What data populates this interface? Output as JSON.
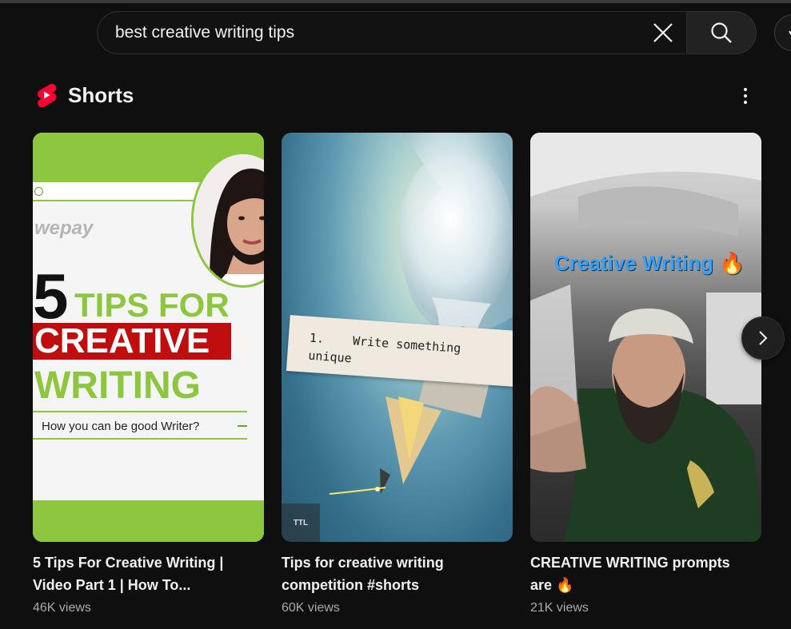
{
  "search": {
    "query": "best creative writing tips"
  },
  "section": {
    "title": "Shorts"
  },
  "icons": {
    "clear": "close-icon",
    "search": "search-icon",
    "more": "more-vert-icon",
    "next": "chevron-right-icon",
    "shorts": "shorts-logo-icon"
  },
  "colors": {
    "background": "#0f0f0f",
    "shorts_red": "#ff0033",
    "views_text": "#aaaaaa"
  },
  "cards": [
    {
      "title_line1": "5 Tips For Creative Writing |",
      "title_line2": "Video Part 1 | How To...",
      "views": "46K views",
      "thumb": {
        "logo": "wepay",
        "big_number": "5",
        "line1": "TIPS FOR",
        "line2": "CREATIVE",
        "line3": "WRITING",
        "question": "How you can be good Writer?"
      }
    },
    {
      "title_line1": "Tips for creative writing",
      "title_line2": "competition #shorts",
      "views": "60K views",
      "thumb": {
        "tape_number": "1.",
        "tape_text": "Write something unique",
        "badge": "TTL"
      }
    },
    {
      "title_line1": "CREATIVE WRITING prompts",
      "title_line2": "are 🔥",
      "views": "21K views",
      "thumb": {
        "overlay": "Creative Writing 🔥"
      }
    }
  ]
}
